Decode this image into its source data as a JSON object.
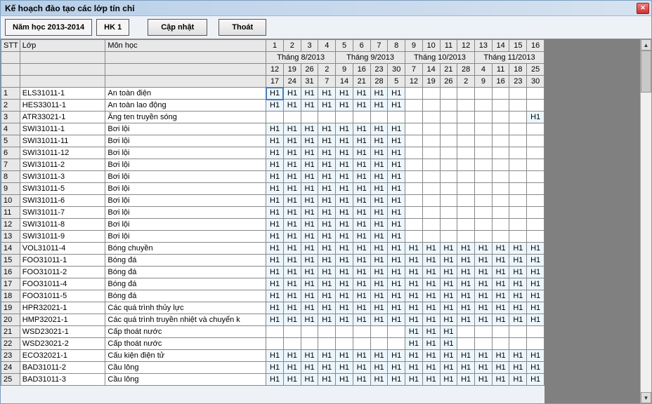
{
  "window": {
    "title": "Kế hoạch đào tạo các lớp tín chỉ"
  },
  "toolbar": {
    "year": "Năm học 2013-2014",
    "semester": "HK 1",
    "update": "Cập nhật",
    "exit": "Thoát"
  },
  "headers": {
    "stt": "STT",
    "lop": "Lớp",
    "mon": "Môn học",
    "weeks": [
      "1",
      "2",
      "3",
      "4",
      "5",
      "6",
      "7",
      "8",
      "9",
      "10",
      "11",
      "12",
      "13",
      "14",
      "15",
      "16"
    ],
    "months": [
      "Tháng 8/2013",
      "Tháng 9/2013",
      "Tháng 10/2013",
      "Tháng 11/2013"
    ],
    "dayrow1": [
      "12",
      "19",
      "26",
      "2",
      "9",
      "16",
      "23",
      "30",
      "7",
      "14",
      "21",
      "28",
      "4",
      "11",
      "18",
      "25"
    ],
    "dayrow2": [
      "17",
      "24",
      "31",
      "7",
      "14",
      "21",
      "28",
      "5",
      "12",
      "19",
      "26",
      "2",
      "9",
      "16",
      "23",
      "30"
    ]
  },
  "rows": [
    {
      "stt": "1",
      "lop": "ELS31011-1",
      "mon": "An toàn điện",
      "cells": [
        "H1",
        "H1",
        "H1",
        "H1",
        "H1",
        "H1",
        "H1",
        "H1",
        "",
        "",
        "",
        "",
        "",
        "",
        "",
        ""
      ],
      "sel": 0
    },
    {
      "stt": "2",
      "lop": "HES33011-1",
      "mon": "An toàn lao động",
      "cells": [
        "H1",
        "H1",
        "H1",
        "H1",
        "H1",
        "H1",
        "H1",
        "H1",
        "",
        "",
        "",
        "",
        "",
        "",
        "",
        ""
      ]
    },
    {
      "stt": "3",
      "lop": "ATR33021-1",
      "mon": "Ăng ten truyền sóng",
      "cells": [
        "",
        "",
        "",
        "",
        "",
        "",
        "",
        "",
        "",
        "",
        "",
        "",
        "",
        "",
        "",
        "H1"
      ]
    },
    {
      "stt": "4",
      "lop": "SWI31011-1",
      "mon": "Bơi lội",
      "cells": [
        "H1",
        "H1",
        "H1",
        "H1",
        "H1",
        "H1",
        "H1",
        "H1",
        "",
        "",
        "",
        "",
        "",
        "",
        "",
        ""
      ]
    },
    {
      "stt": "5",
      "lop": "SWI31011-11",
      "mon": "Bơi lội",
      "cells": [
        "H1",
        "H1",
        "H1",
        "H1",
        "H1",
        "H1",
        "H1",
        "H1",
        "",
        "",
        "",
        "",
        "",
        "",
        "",
        ""
      ]
    },
    {
      "stt": "6",
      "lop": "SWI31011-12",
      "mon": "Bơi lội",
      "cells": [
        "H1",
        "H1",
        "H1",
        "H1",
        "H1",
        "H1",
        "H1",
        "H1",
        "",
        "",
        "",
        "",
        "",
        "",
        "",
        ""
      ]
    },
    {
      "stt": "7",
      "lop": "SWI31011-2",
      "mon": "Bơi lội",
      "cells": [
        "H1",
        "H1",
        "H1",
        "H1",
        "H1",
        "H1",
        "H1",
        "H1",
        "",
        "",
        "",
        "",
        "",
        "",
        "",
        ""
      ]
    },
    {
      "stt": "8",
      "lop": "SWI31011-3",
      "mon": "Bơi lội",
      "cells": [
        "H1",
        "H1",
        "H1",
        "H1",
        "H1",
        "H1",
        "H1",
        "H1",
        "",
        "",
        "",
        "",
        "",
        "",
        "",
        ""
      ]
    },
    {
      "stt": "9",
      "lop": "SWI31011-5",
      "mon": "Bơi lội",
      "cells": [
        "H1",
        "H1",
        "H1",
        "H1",
        "H1",
        "H1",
        "H1",
        "H1",
        "",
        "",
        "",
        "",
        "",
        "",
        "",
        ""
      ]
    },
    {
      "stt": "10",
      "lop": "SWI31011-6",
      "mon": "Bơi lội",
      "cells": [
        "H1",
        "H1",
        "H1",
        "H1",
        "H1",
        "H1",
        "H1",
        "H1",
        "",
        "",
        "",
        "",
        "",
        "",
        "",
        ""
      ]
    },
    {
      "stt": "11",
      "lop": "SWI31011-7",
      "mon": "Bơi lội",
      "cells": [
        "H1",
        "H1",
        "H1",
        "H1",
        "H1",
        "H1",
        "H1",
        "H1",
        "",
        "",
        "",
        "",
        "",
        "",
        "",
        ""
      ]
    },
    {
      "stt": "12",
      "lop": "SWI31011-8",
      "mon": "Bơi lội",
      "cells": [
        "H1",
        "H1",
        "H1",
        "H1",
        "H1",
        "H1",
        "H1",
        "H1",
        "",
        "",
        "",
        "",
        "",
        "",
        "",
        ""
      ]
    },
    {
      "stt": "13",
      "lop": "SWI31011-9",
      "mon": "Bơi lội",
      "cells": [
        "H1",
        "H1",
        "H1",
        "H1",
        "H1",
        "H1",
        "H1",
        "H1",
        "",
        "",
        "",
        "",
        "",
        "",
        "",
        ""
      ]
    },
    {
      "stt": "14",
      "lop": "VOL31011-4",
      "mon": "Bóng chuyền",
      "cells": [
        "H1",
        "H1",
        "H1",
        "H1",
        "H1",
        "H1",
        "H1",
        "H1",
        "H1",
        "H1",
        "H1",
        "H1",
        "H1",
        "H1",
        "H1",
        "H1"
      ]
    },
    {
      "stt": "15",
      "lop": "FOO31011-1",
      "mon": "Bóng đá",
      "cells": [
        "H1",
        "H1",
        "H1",
        "H1",
        "H1",
        "H1",
        "H1",
        "H1",
        "H1",
        "H1",
        "H1",
        "H1",
        "H1",
        "H1",
        "H1",
        "H1"
      ]
    },
    {
      "stt": "16",
      "lop": "FOO31011-2",
      "mon": "Bóng đá",
      "cells": [
        "H1",
        "H1",
        "H1",
        "H1",
        "H1",
        "H1",
        "H1",
        "H1",
        "H1",
        "H1",
        "H1",
        "H1",
        "H1",
        "H1",
        "H1",
        "H1"
      ]
    },
    {
      "stt": "17",
      "lop": "FOO31011-4",
      "mon": "Bóng đá",
      "cells": [
        "H1",
        "H1",
        "H1",
        "H1",
        "H1",
        "H1",
        "H1",
        "H1",
        "H1",
        "H1",
        "H1",
        "H1",
        "H1",
        "H1",
        "H1",
        "H1"
      ]
    },
    {
      "stt": "18",
      "lop": "FOO31011-5",
      "mon": "Bóng đá",
      "cells": [
        "H1",
        "H1",
        "H1",
        "H1",
        "H1",
        "H1",
        "H1",
        "H1",
        "H1",
        "H1",
        "H1",
        "H1",
        "H1",
        "H1",
        "H1",
        "H1"
      ]
    },
    {
      "stt": "19",
      "lop": "HPR32021-1",
      "mon": "Các quá trình thủy lực",
      "cells": [
        "H1",
        "H1",
        "H1",
        "H1",
        "H1",
        "H1",
        "H1",
        "H1",
        "H1",
        "H1",
        "H1",
        "H1",
        "H1",
        "H1",
        "H1",
        "H1"
      ]
    },
    {
      "stt": "20",
      "lop": "HMP32021-1",
      "mon": "Các quá trình truyền nhiệt  và chuyển  k",
      "cells": [
        "H1",
        "H1",
        "H1",
        "H1",
        "H1",
        "H1",
        "H1",
        "H1",
        "H1",
        "H1",
        "H1",
        "H1",
        "H1",
        "H1",
        "H1",
        "H1"
      ]
    },
    {
      "stt": "21",
      "lop": "WSD23021-1",
      "mon": "Cấp thoát nước",
      "cells": [
        "",
        "",
        "",
        "",
        "",
        "",
        "",
        "",
        "H1",
        "H1",
        "H1",
        "",
        "",
        "",
        "",
        ""
      ]
    },
    {
      "stt": "22",
      "lop": "WSD23021-2",
      "mon": "Cấp thoát nước",
      "cells": [
        "",
        "",
        "",
        "",
        "",
        "",
        "",
        "",
        "H1",
        "H1",
        "H1",
        "",
        "",
        "",
        "",
        ""
      ]
    },
    {
      "stt": "23",
      "lop": "ECO32021-1",
      "mon": "Cấu kiện điện tử",
      "cells": [
        "H1",
        "H1",
        "H1",
        "H1",
        "H1",
        "H1",
        "H1",
        "H1",
        "H1",
        "H1",
        "H1",
        "H1",
        "H1",
        "H1",
        "H1",
        "H1"
      ]
    },
    {
      "stt": "24",
      "lop": "BAD31011-2",
      "mon": "Cầu lông",
      "cells": [
        "H1",
        "H1",
        "H1",
        "H1",
        "H1",
        "H1",
        "H1",
        "H1",
        "H1",
        "H1",
        "H1",
        "H1",
        "H1",
        "H1",
        "H1",
        "H1"
      ]
    },
    {
      "stt": "25",
      "lop": "BAD31011-3",
      "mon": "Cầu lông",
      "cells": [
        "H1",
        "H1",
        "H1",
        "H1",
        "H1",
        "H1",
        "H1",
        "H1",
        "H1",
        "H1",
        "H1",
        "H1",
        "H1",
        "H1",
        "H1",
        "H1"
      ]
    }
  ]
}
